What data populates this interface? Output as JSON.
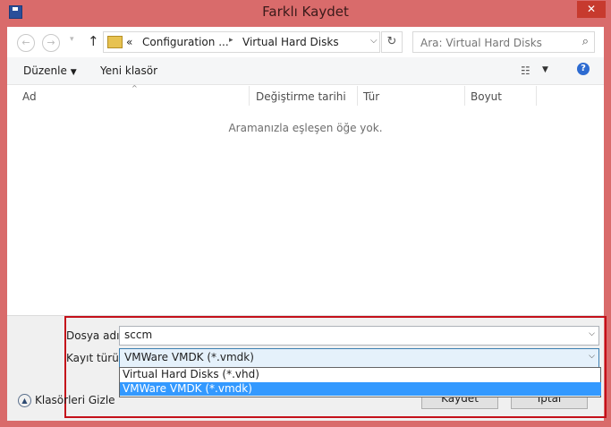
{
  "window": {
    "title": "Farklı Kaydet",
    "close_glyph": "✕",
    "app_icon": "floppy-disk-icon"
  },
  "nav": {
    "back_glyph": "←",
    "forward_glyph": "→",
    "recent_glyph": "▾",
    "up_glyph": "↑",
    "breadcrumb": {
      "overflow": "«",
      "items": [
        "Configuration ...",
        "Virtual Hard Disks"
      ],
      "separator": "▸",
      "dropdown": "⌵"
    },
    "refresh_glyph": "↻",
    "search_placeholder": "Ara: Virtual Hard Disks",
    "search_glyph": "⌕"
  },
  "toolbar": {
    "organize": "Düzenle",
    "organize_arrow": "▼",
    "new_folder": "Yeni klasör",
    "view_glyph": "☷",
    "view_arrow": "▼",
    "help_glyph": "?"
  },
  "columns": [
    "Ad",
    "Değiştirme tarihi",
    "Tür",
    "Boyut"
  ],
  "sort_glyph": "^",
  "empty_message": "Aramanızla eşleşen öğe yok.",
  "form": {
    "filename_label": "Dosya adı:",
    "filename_value": "sccm",
    "type_label": "Kayıt türü:",
    "type_value": "VMWare VMDK (*.vmdk)",
    "drop_glyph": "⌵",
    "type_options": [
      {
        "label": "Virtual Hard Disks (*.vhd)",
        "selected": false
      },
      {
        "label": "VMWare VMDK (*.vmdk)",
        "selected": true
      }
    ]
  },
  "footer": {
    "hide_folders": "Klasörleri Gizle",
    "hide_glyph": "▲",
    "save": "Kaydet",
    "cancel": "İptal"
  },
  "colors": {
    "frame": "#d96b6b",
    "highlight_border": "#c4101a",
    "selection": "#3399ff",
    "close_button": "#c73a2e"
  }
}
